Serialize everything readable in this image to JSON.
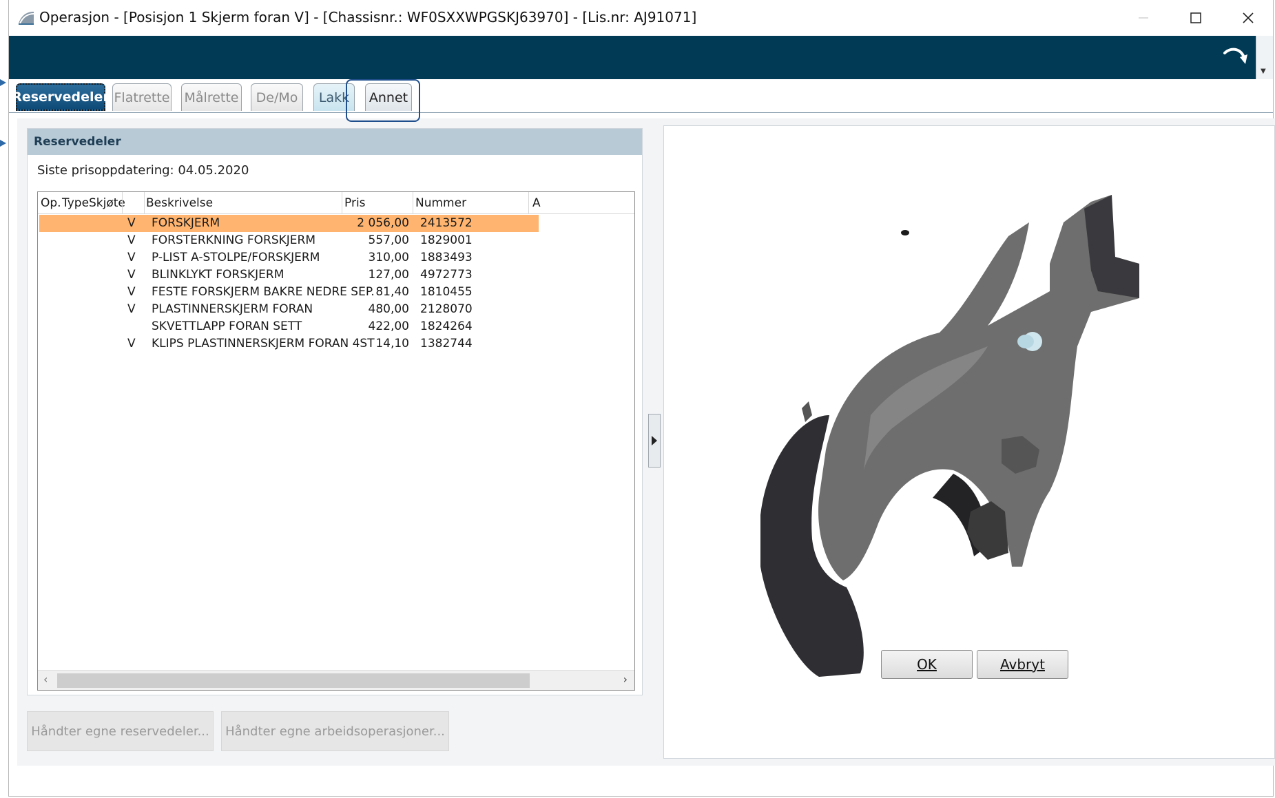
{
  "window": {
    "title": "Operasjon - [Posisjon 1 Skjerm foran V] - [Chassisnr.: WF0SXXWPGSKJ63970] -  [Lis.nr: AJ91071]"
  },
  "tabs": [
    {
      "label": "Reservedeler",
      "active": true
    },
    {
      "label": "Flatrette"
    },
    {
      "label": "Målrette"
    },
    {
      "label": "De/Mo"
    },
    {
      "label": "Lakk"
    },
    {
      "label": "Annet"
    }
  ],
  "parts_panel": {
    "header": "Reservedeler",
    "price_update": "Siste prisoppdatering: 04.05.2020",
    "columns": [
      "Op.",
      "Type",
      "Skjøte",
      "Beskrivelse",
      "Pris",
      "Nummer",
      "A"
    ],
    "rows": [
      {
        "side": "V",
        "desc": "FORSKJERM",
        "price": "2 056,00",
        "number": "2413572",
        "selected": true
      },
      {
        "side": "V",
        "desc": "FORSTERKNING FORSKJERM",
        "price": "557,00",
        "number": "1829001"
      },
      {
        "side": "V",
        "desc": "P-LIST A-STOLPE/FORSKJERM",
        "price": "310,00",
        "number": "1883493"
      },
      {
        "side": "V",
        "desc": "BLINKLYKT FORSKJERM",
        "price": "127,00",
        "number": "4972773"
      },
      {
        "side": "V",
        "desc": "FESTE FORSKJERM BAKRE NEDRE SEP.",
        "price": "81,40",
        "number": "1810455"
      },
      {
        "side": "V",
        "desc": "PLASTINNERSKJERM FORAN",
        "price": "480,00",
        "number": "2128070"
      },
      {
        "side": "",
        "desc": "SKVETTLAPP FORAN SETT",
        "price": "422,00",
        "number": "1824264"
      },
      {
        "side": "V",
        "desc": "KLIPS PLASTINNERSKJERM FORAN 4ST",
        "price": "14,10",
        "number": "1382744"
      }
    ]
  },
  "buttons": {
    "own_parts": "Håndter egne reservedeler...",
    "own_operations": "Håndter egne arbeidsoperasjoner...",
    "ok": "OK",
    "cancel": "Avbryt"
  },
  "colors": {
    "banner": "#003a55",
    "active_tab": "#0e4a78",
    "selected_row": "#ffb570",
    "panel_header": "#b7cad6"
  },
  "icons": {
    "app": "app-logo-icon",
    "undo": "undo-arrow-icon",
    "minimize": "minimize-icon",
    "maximize": "maximize-icon",
    "close": "close-icon",
    "splitter": "expand-right-icon"
  }
}
